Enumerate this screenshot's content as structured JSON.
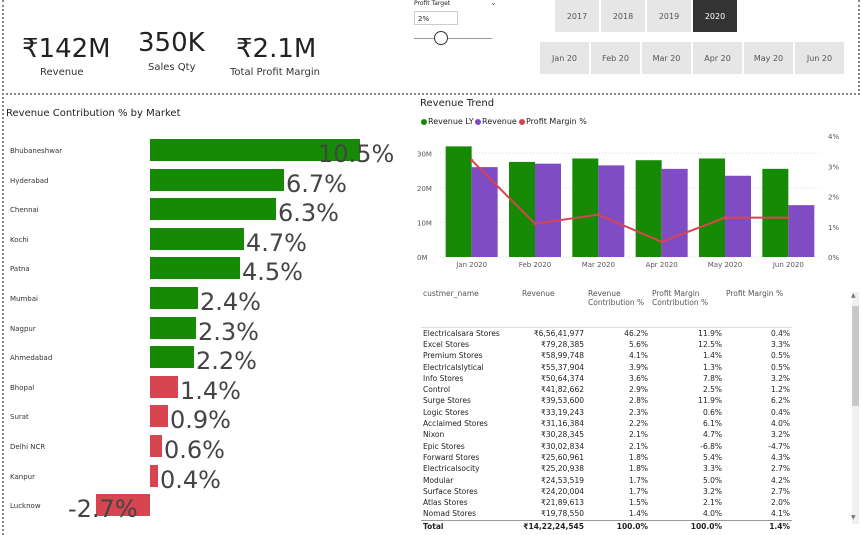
{
  "colors": {
    "green": "#168a05",
    "purple": "#7f4cc4",
    "red": "#d64550",
    "selected": "#333333"
  },
  "kpis": [
    {
      "value": "₹142M",
      "label": "Revenue"
    },
    {
      "value": "350K",
      "label": "Sales Qty"
    },
    {
      "value": "₹2.1M",
      "label": "Total Profit Margin"
    }
  ],
  "profit_target": {
    "label": "Profit Target",
    "value": "2%",
    "slider_fraction": 0.35
  },
  "years": {
    "items": [
      "2017",
      "2018",
      "2019",
      "2020"
    ],
    "selected": "2020"
  },
  "months": {
    "items": [
      "Jan 20",
      "Feb 20",
      "Mar 20",
      "Apr 20",
      "May 20",
      "Jun 20"
    ]
  },
  "market_chart": {
    "title": "Revenue Contribution % by Market",
    "items": [
      {
        "market": "Bhubaneshwar",
        "value": 10.5,
        "label": "10.5%"
      },
      {
        "market": "Hyderabad",
        "value": 6.7,
        "label": "6.7%"
      },
      {
        "market": "Chennai",
        "value": 6.3,
        "label": "6.3%"
      },
      {
        "market": "Kochi",
        "value": 4.7,
        "label": "4.7%"
      },
      {
        "market": "Patna",
        "value": 4.5,
        "label": "4.5%"
      },
      {
        "market": "Mumbai",
        "value": 2.4,
        "label": "2.4%"
      },
      {
        "market": "Nagpur",
        "value": 2.3,
        "label": "2.3%"
      },
      {
        "market": "Ahmedabad",
        "value": 2.2,
        "label": "2.2%"
      },
      {
        "market": "Bhopal",
        "value": 1.4,
        "label": "1.4%"
      },
      {
        "market": "Surat",
        "value": 0.9,
        "label": "0.9%"
      },
      {
        "market": "Delhi NCR",
        "value": 0.6,
        "label": "0.6%"
      },
      {
        "market": "Kanpur",
        "value": 0.4,
        "label": "0.4%"
      },
      {
        "market": "Lucknow",
        "value": -2.7,
        "label": "-2.7%"
      }
    ]
  },
  "trend_chart": {
    "title": "Revenue Trend",
    "legend": [
      "Revenue LY",
      "Revenue",
      "Profit Margin %"
    ],
    "left_ticks": [
      "30M",
      "20M",
      "10M",
      "0M"
    ],
    "right_ticks": [
      "4%",
      "3%",
      "2%",
      "1%",
      "0%"
    ]
  },
  "chart_data": {
    "type": "bar",
    "categories": [
      "Jan 2020",
      "Feb 2020",
      "Mar 2020",
      "Apr 2020",
      "May 2020",
      "Jun 2020"
    ],
    "series": [
      {
        "name": "Revenue LY",
        "values": [
          32,
          27.5,
          28.5,
          28,
          28.5,
          25.5
        ]
      },
      {
        "name": "Revenue",
        "values": [
          26,
          27,
          26.5,
          25.5,
          23.5,
          15
        ]
      },
      {
        "name": "Profit Margin %",
        "values": [
          3.2,
          1.1,
          1.4,
          0.5,
          1.3,
          1.3
        ]
      }
    ],
    "ylim": [
      0,
      35
    ],
    "y2lim": [
      0,
      4
    ]
  },
  "table": {
    "columns": [
      "custmer_name",
      "Revenue",
      "Revenue Contribution %",
      "Profit Margin Contribution %",
      "Profit Margin %"
    ],
    "rows": [
      [
        "Electricalsara Stores",
        "₹6,56,41,977",
        "46.2%",
        "11.9%",
        "0.4%"
      ],
      [
        "Excel Stores",
        "₹79,28,385",
        "5.6%",
        "12.5%",
        "3.3%"
      ],
      [
        "Premium Stores",
        "₹58,99,748",
        "4.1%",
        "1.4%",
        "0.5%"
      ],
      [
        "Electricalslytical",
        "₹55,37,904",
        "3.9%",
        "1.3%",
        "0.5%"
      ],
      [
        "Info Stores",
        "₹50,64,374",
        "3.6%",
        "7.8%",
        "3.2%"
      ],
      [
        "Control",
        "₹41,82,662",
        "2.9%",
        "2.5%",
        "1.2%"
      ],
      [
        "Surge Stores",
        "₹39,53,600",
        "2.8%",
        "11.9%",
        "6.2%"
      ],
      [
        "Logic Stores",
        "₹33,19,243",
        "2.3%",
        "0.6%",
        "0.4%"
      ],
      [
        "Acclaimed Stores",
        "₹31,16,384",
        "2.2%",
        "6.1%",
        "4.0%"
      ],
      [
        "Nixon",
        "₹30,28,345",
        "2.1%",
        "4.7%",
        "3.2%"
      ],
      [
        "Epic Stores",
        "₹30,02,834",
        "2.1%",
        "-6.8%",
        "-4.7%"
      ],
      [
        "Forward Stores",
        "₹25,60,961",
        "1.8%",
        "5.4%",
        "4.3%"
      ],
      [
        "Electricalsocity",
        "₹25,20,938",
        "1.8%",
        "3.3%",
        "2.7%"
      ],
      [
        "Modular",
        "₹24,53,519",
        "1.7%",
        "5.0%",
        "4.2%"
      ],
      [
        "Surface Stores",
        "₹24,20,004",
        "1.7%",
        "3.2%",
        "2.7%"
      ],
      [
        "Atlas Stores",
        "₹21,89,613",
        "1.5%",
        "2.1%",
        "2.0%"
      ],
      [
        "Nomad Stores",
        "₹19,78,550",
        "1.4%",
        "4.0%",
        "4.1%"
      ]
    ],
    "total": [
      "Total",
      "₹14,22,24,545",
      "100.0%",
      "100.0%",
      "1.4%"
    ]
  }
}
